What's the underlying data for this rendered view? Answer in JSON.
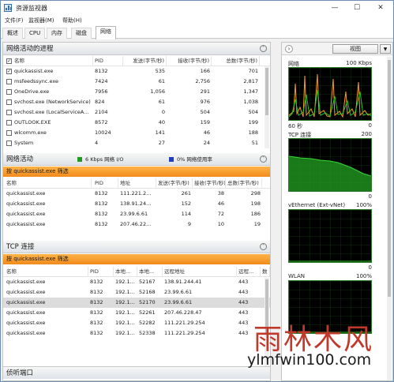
{
  "window": {
    "title": "资源监视器",
    "min": "—",
    "max": "☐",
    "close": "✕"
  },
  "menu": [
    "文件(F)",
    "监视器(M)",
    "帮助(H)"
  ],
  "tabs": [
    "概述",
    "CPU",
    "内存",
    "磁盘",
    "网络"
  ],
  "active_tab": "网络",
  "processes": {
    "title": "网络活动的进程",
    "columns": [
      "名称",
      "PID",
      "发送(字节/秒)",
      "接收(字节/秒)",
      "总数(字节/秒)"
    ],
    "rows": [
      {
        "checked": true,
        "name": "quickassist.exe",
        "pid": "8132",
        "send": "535",
        "recv": "166",
        "total": "701"
      },
      {
        "checked": false,
        "name": "msfeedssync.exe",
        "pid": "7424",
        "send": "61",
        "recv": "2,756",
        "total": "2,817"
      },
      {
        "checked": false,
        "name": "OneDrive.exe",
        "pid": "7956",
        "send": "1,056",
        "recv": "291",
        "total": "1,347"
      },
      {
        "checked": false,
        "name": "svchost.exe (NetworkService)",
        "pid": "824",
        "send": "61",
        "recv": "976",
        "total": "1,038"
      },
      {
        "checked": false,
        "name": "svchost.exe (LocalServiceA...",
        "pid": "2104",
        "send": "0",
        "recv": "504",
        "total": "504"
      },
      {
        "checked": false,
        "name": "OUTLOOK.EXE",
        "pid": "8572",
        "send": "40",
        "recv": "159",
        "total": "199"
      },
      {
        "checked": false,
        "name": "wlcomm.exe",
        "pid": "10024",
        "send": "141",
        "recv": "46",
        "total": "188"
      },
      {
        "checked": false,
        "name": "System",
        "pid": "4",
        "send": "27",
        "recv": "24",
        "total": "51"
      }
    ]
  },
  "network_activity": {
    "title": "网络活动",
    "io_label": "6 Kbps 网络 I/O",
    "usage_label": "0% 网络使用率",
    "io_color": "#1f9a1f",
    "usage_color": "#1f3fbf",
    "filter": "按 quickassist.exe 筛选",
    "columns": [
      "名称",
      "PID",
      "地址",
      "发送(字节/秒)",
      "接收(字节/秒)",
      "总数(字节/秒)"
    ],
    "rows": [
      {
        "name": "quickassist.exe",
        "pid": "8132",
        "addr": "111.221.2...",
        "send": "261",
        "recv": "38",
        "total": "298"
      },
      {
        "name": "quickassist.exe",
        "pid": "8132",
        "addr": "138.91.24...",
        "send": "152",
        "recv": "46",
        "total": "198"
      },
      {
        "name": "quickassist.exe",
        "pid": "8132",
        "addr": "23.99.6.61",
        "send": "114",
        "recv": "72",
        "total": "186"
      },
      {
        "name": "quickassist.exe",
        "pid": "8132",
        "addr": "207.46.22...",
        "send": "9",
        "recv": "10",
        "total": "19"
      }
    ]
  },
  "tcp": {
    "title": "TCP 连接",
    "filter": "按 quickassist.exe 筛选",
    "columns": [
      "名称",
      "PID",
      "本地...",
      "本地...",
      "远程地址",
      "远程...",
      "数"
    ],
    "rows": [
      {
        "name": "quickassist.exe",
        "pid": "8132",
        "laddr": "192.1...",
        "lport": "52167",
        "raddr": "138.91.244.41",
        "rport": "443",
        "selected": false
      },
      {
        "name": "quickassist.exe",
        "pid": "8132",
        "laddr": "192.1...",
        "lport": "52168",
        "raddr": "23.99.6.61",
        "rport": "443",
        "selected": false
      },
      {
        "name": "quickassist.exe",
        "pid": "8132",
        "laddr": "192.1...",
        "lport": "52170",
        "raddr": "23.99.6.61",
        "rport": "443",
        "selected": true
      },
      {
        "name": "quickassist.exe",
        "pid": "8132",
        "laddr": "192.1...",
        "lport": "52261",
        "raddr": "207.46.228.47",
        "rport": "443",
        "selected": false
      },
      {
        "name": "quickassist.exe",
        "pid": "8132",
        "laddr": "192.1...",
        "lport": "52282",
        "raddr": "111.221.29.254",
        "rport": "443",
        "selected": false
      },
      {
        "name": "quickassist.exe",
        "pid": "8132",
        "laddr": "192.1...",
        "lport": "52338",
        "raddr": "111.221.29.254",
        "rport": "443",
        "selected": false
      }
    ]
  },
  "listening": {
    "title": "侦听端口"
  },
  "right_panel": {
    "view_button": "视图",
    "graphs": [
      {
        "name": "网络",
        "max": "100 Kbps",
        "foot_left": "60 秒",
        "foot_right": "0"
      },
      {
        "name": "TCP 连接",
        "max": "200",
        "foot_left": "",
        "foot_right": "0"
      },
      {
        "name": "vEthernet (Ext-vNet)",
        "max": "100%",
        "foot_left": "",
        "foot_right": "0"
      },
      {
        "name": "WLAN",
        "max": "100%",
        "foot_left": "",
        "foot_right": ""
      }
    ]
  },
  "watermark": {
    "big": "雨林木风",
    "small": "ylmfwin100.com"
  }
}
